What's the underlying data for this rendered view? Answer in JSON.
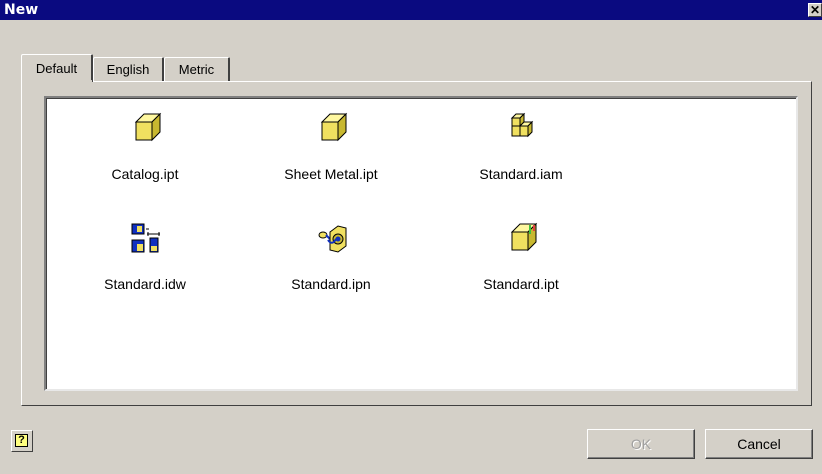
{
  "window": {
    "title": "New",
    "close_glyph": "✕"
  },
  "tabs": [
    {
      "label": "Default",
      "active": true
    },
    {
      "label": "English",
      "active": false
    },
    {
      "label": "Metric",
      "active": false
    }
  ],
  "templates": [
    {
      "label": "Catalog.ipt",
      "icon": "part-cube-icon"
    },
    {
      "label": "Sheet Metal.ipt",
      "icon": "sheet-metal-cube-icon"
    },
    {
      "label": "Standard.iam",
      "icon": "assembly-icon"
    },
    {
      "label": "Standard.idw",
      "icon": "drawing-icon"
    },
    {
      "label": "Standard.ipn",
      "icon": "presentation-icon"
    },
    {
      "label": "Standard.ipt",
      "icon": "standard-part-icon"
    }
  ],
  "buttons": {
    "help": "?",
    "ok": "OK",
    "cancel": "Cancel",
    "ok_enabled": false
  },
  "colors": {
    "titlebar": "#0a0a80",
    "dialog": "#d4d0c8",
    "icon_yellow": "#f0e060"
  }
}
